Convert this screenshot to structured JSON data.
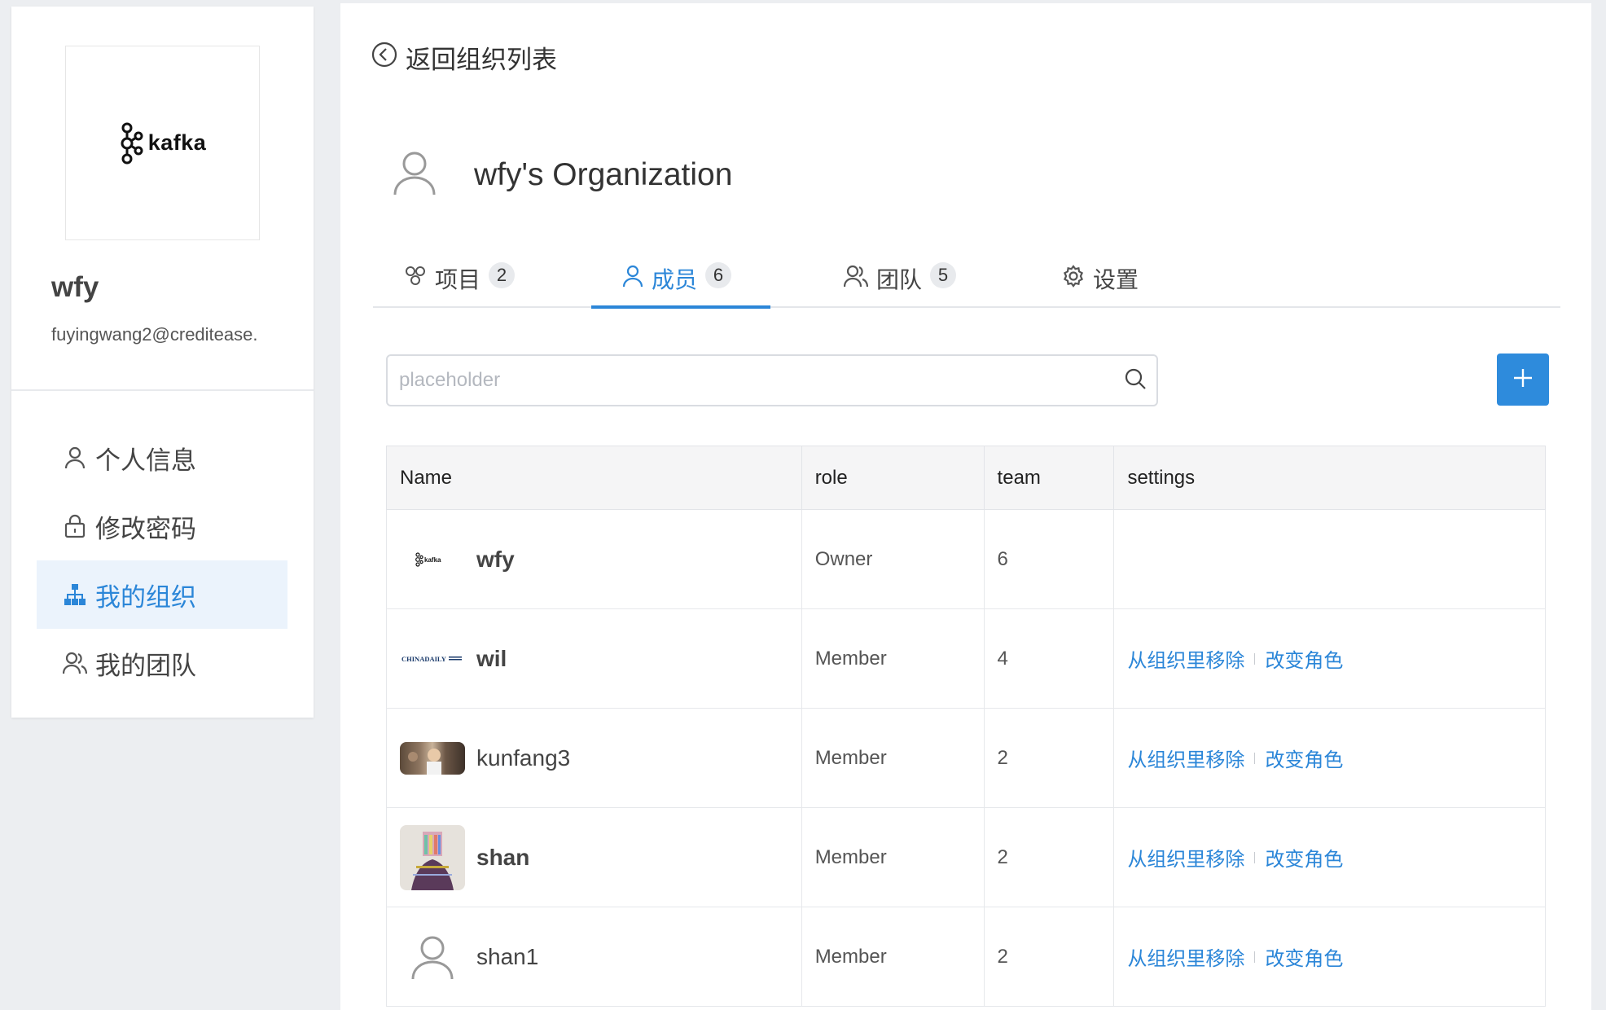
{
  "sidebar": {
    "logo_text": "kafka",
    "profile_name": "wfy",
    "profile_email": "fuyingwang2@creditease.",
    "nav": [
      {
        "label": "个人信息",
        "icon": "user-icon"
      },
      {
        "label": "修改密码",
        "icon": "lock-icon"
      },
      {
        "label": "我的组织",
        "icon": "org-tree-icon"
      },
      {
        "label": "我的团队",
        "icon": "team-icon"
      }
    ]
  },
  "header": {
    "back_label": "返回组织列表",
    "org_title": "wfy's Organization"
  },
  "tabs": [
    {
      "label": "项目",
      "count": "2",
      "icon": "project-icon"
    },
    {
      "label": "成员",
      "count": "6",
      "icon": "user-icon"
    },
    {
      "label": "团队",
      "count": "5",
      "icon": "team-icon"
    },
    {
      "label": "设置",
      "icon": "gear-icon"
    }
  ],
  "search": {
    "placeholder": "placeholder",
    "value": ""
  },
  "table": {
    "columns": [
      "Name",
      "role",
      "team",
      "settings"
    ],
    "rows": [
      {
        "name": "wfy",
        "role": "Owner",
        "team": "6",
        "avatar": "kafka-logo"
      },
      {
        "name": "wil",
        "role": "Member",
        "team": "4",
        "avatar": "chinadaily-logo"
      },
      {
        "name": "kunfang3",
        "role": "Member",
        "team": "2",
        "avatar": "photo"
      },
      {
        "name": "shan",
        "role": "Member",
        "team": "2",
        "avatar": "photo"
      },
      {
        "name": "shan1",
        "role": "Member",
        "team": "2",
        "avatar": "default-user-icon"
      }
    ],
    "actions": {
      "remove": "从组织里移除",
      "change_role": "改变角色"
    }
  },
  "colors": {
    "accent": "#2b86d8",
    "add_button": "#2e8bdc",
    "active_nav_bg": "#ebf3fc"
  }
}
